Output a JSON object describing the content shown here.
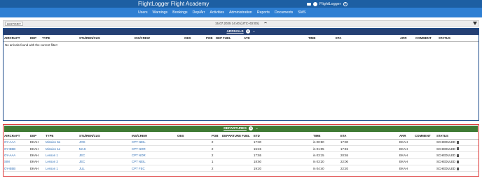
{
  "header": {
    "brand": "FlightLogger Flight Academy",
    "user_label": "FlightLogger",
    "help_glyph": "?"
  },
  "nav": [
    "Users",
    "Warnings",
    "Bookings",
    "Dep/Arr",
    "Activities",
    "Administration",
    "Reports",
    "Documents",
    "SMS"
  ],
  "filterbar": {
    "history_label": "HISTORY",
    "datetime": "15.07.2025 14:40 (UTC+02:00)"
  },
  "arrivals": {
    "title": "ARRIVALS",
    "count": "0",
    "columns": [
      "AIRCRAFT",
      "DEP",
      "TYPE",
      "STU/REN/CUS",
      "INS/CREW",
      "OBS",
      "POB",
      "DEP FUEL",
      "ATD",
      "TIME",
      "ETA",
      "ARR",
      "COMMENT",
      "STATUS"
    ],
    "empty_message": "No arrivals found with the current filter!"
  },
  "departures": {
    "title": "DEPARTURES",
    "count": "5",
    "columns": [
      "AIRCRAFT",
      "DEP",
      "TYPE",
      "STU/REN/CUS",
      "INS/CREW",
      "OBS",
      "POB",
      "DEPARTURE FUEL",
      "ETD",
      "TIME",
      "ETA",
      "ARR",
      "COMMENT",
      "STATUS"
    ],
    "rows": [
      {
        "aircraft": "OY-AAA",
        "dep": "EKAH",
        "type": "Mission 3a",
        "stu": "JOS",
        "ins": "CPT NEIL",
        "obs": "",
        "pob": "2",
        "fuel": "",
        "etd": "17:30",
        "time": "in 00:50",
        "eta": "17:30",
        "arr": "EKAH",
        "comment": "",
        "status": "SCHEDULED"
      },
      {
        "aircraft": "OY-BBB",
        "dep": "EKAH",
        "type": "Mission 1a",
        "stu": "MAS",
        "ins": "CPT NOR",
        "obs": "",
        "pob": "2",
        "fuel": "",
        "etd": "15:45",
        "time": "in 01:05",
        "eta": "17:45",
        "arr": "EKAH",
        "comment": "",
        "status": "SCHEDULED"
      },
      {
        "aircraft": "OY-AAA",
        "dep": "EKAH",
        "type": "Lesson 1",
        "stu": "JEC",
        "ins": "CPT NOR",
        "obs": "",
        "pob": "2",
        "fuel": "",
        "etd": "17:55",
        "time": "in 03:15",
        "eta": "20:55",
        "arr": "EKAH",
        "comment": "",
        "status": "SCHEDULED"
      },
      {
        "aircraft": "SIM",
        "dep": "EKAH",
        "type": "Lesson 2",
        "stu": "JEC",
        "ins": "CPT NEIL",
        "obs": "",
        "pob": "1",
        "fuel": "",
        "etd": "18:50",
        "time": "in 03:20",
        "eta": "22:00",
        "arr": "EKAH",
        "comment": "",
        "status": "SCHEDULED"
      },
      {
        "aircraft": "OY-BBB",
        "dep": "EKAH",
        "type": "Lesson 1",
        "stu": "JUL",
        "ins": "CPT FEC",
        "obs": "",
        "pob": "2",
        "fuel": "",
        "etd": "19:20",
        "time": "in 04:40",
        "eta": "22:20",
        "arr": "EKAH",
        "comment": "",
        "status": "SCHEDULED"
      }
    ]
  },
  "colors": {
    "topbar": "#1d5fa3",
    "navbar": "#2e7fd3",
    "arrivals_header": "#243f73",
    "departures_header": "#3f7a34",
    "link": "#2f6eb5",
    "highlight_border": "#dd3333"
  }
}
